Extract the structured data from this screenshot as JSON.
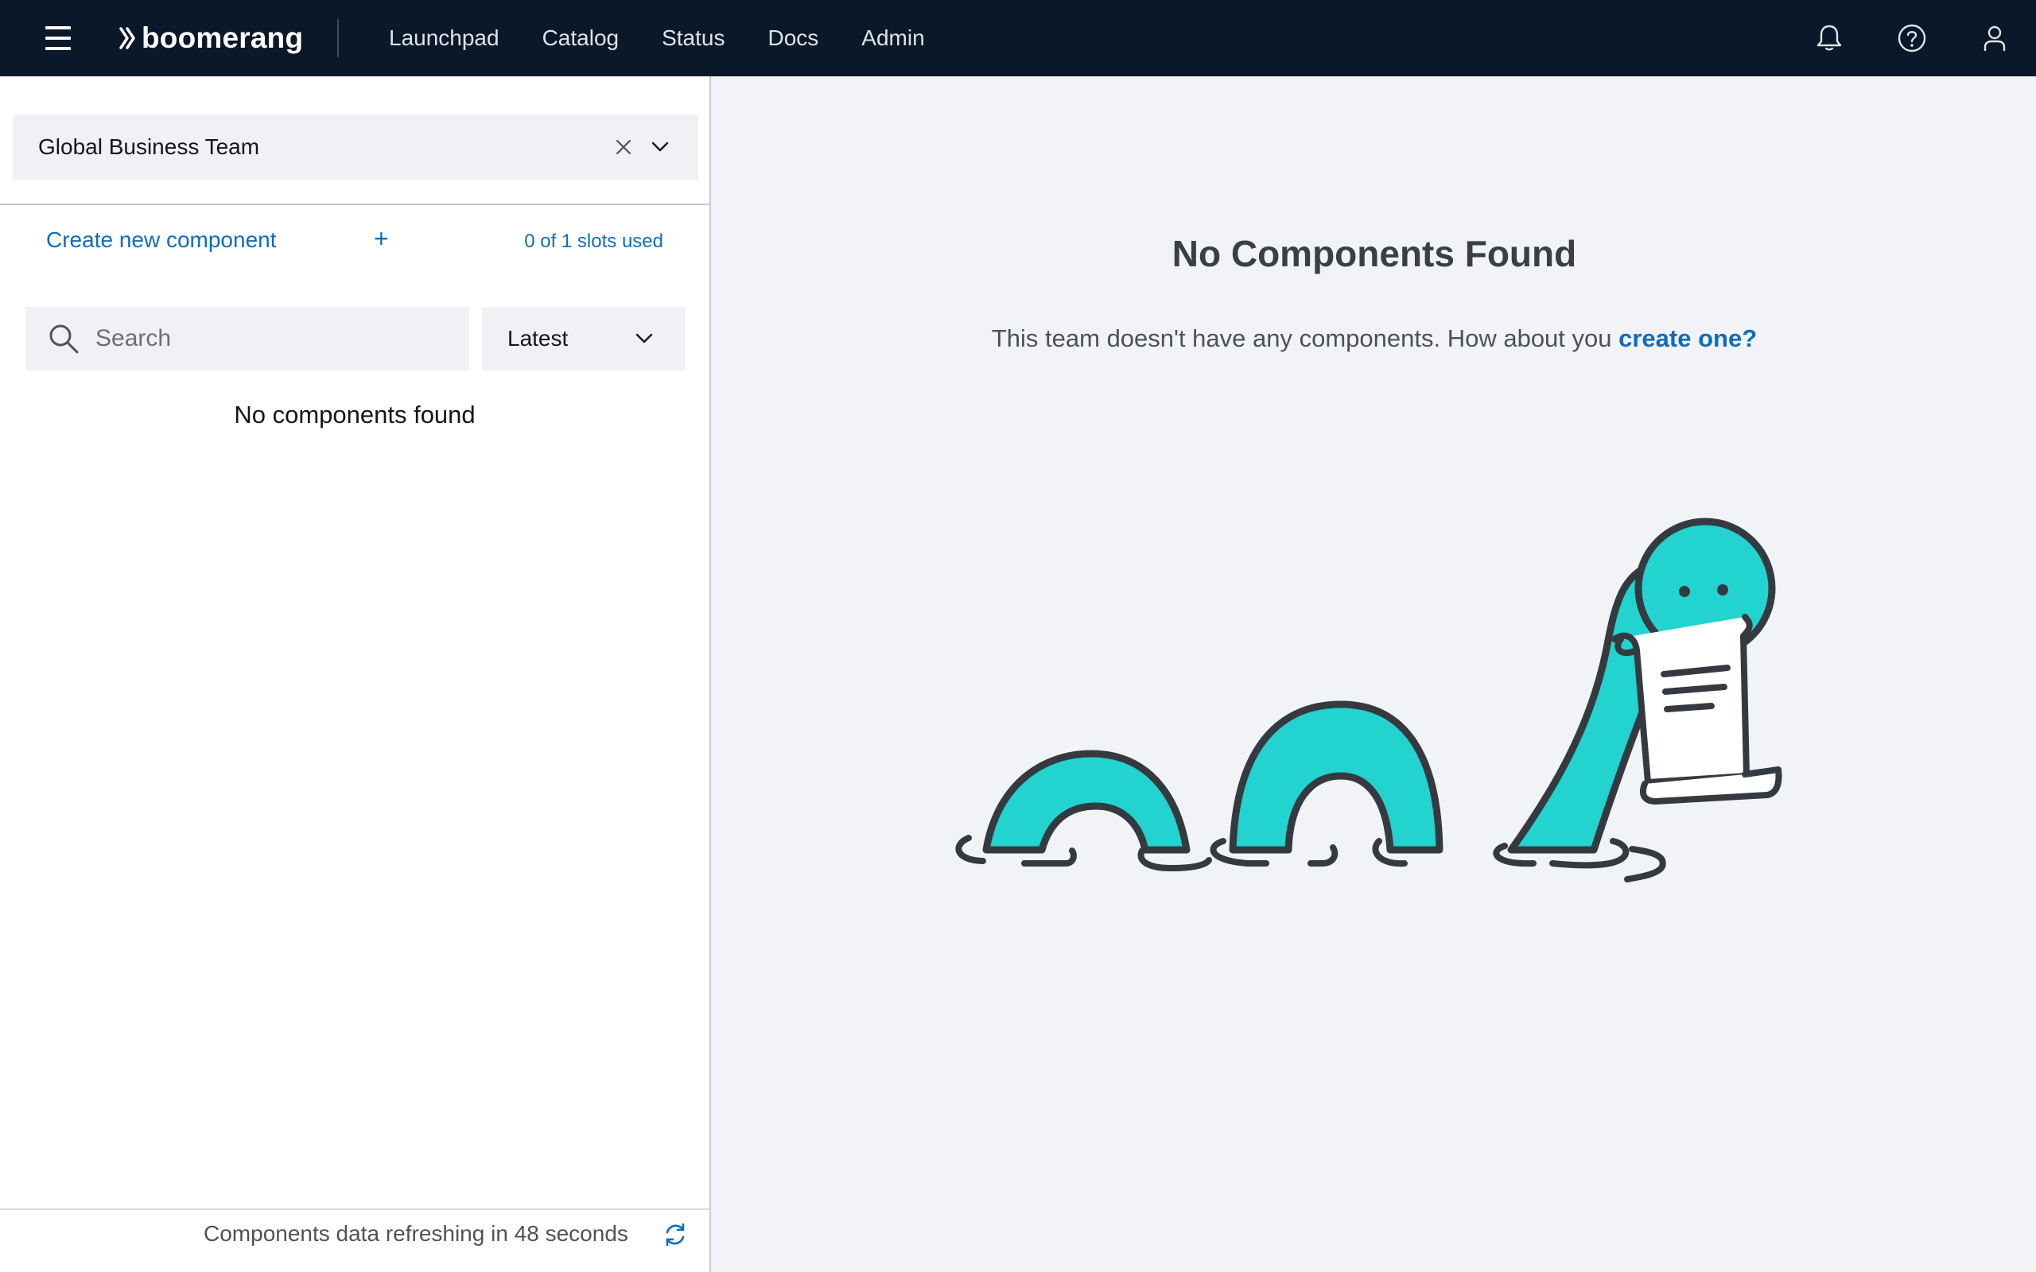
{
  "header": {
    "brand": "boomerang",
    "nav": [
      "Launchpad",
      "Catalog",
      "Status",
      "Docs",
      "Admin"
    ]
  },
  "sidebar": {
    "team_select": "Global Business Team",
    "create_label": "Create new component",
    "create_plus": "+",
    "slots": "0 of 1 slots used",
    "search_placeholder": "Search",
    "sort_value": "Latest",
    "empty_text": "No components found",
    "refresh_text": "Components data refreshing in 48 seconds"
  },
  "main": {
    "title": "No Components Found",
    "subtitle_prefix": "This team doesn't have any components. How about you ",
    "subtitle_link": "create one?"
  },
  "colors": {
    "header_bg": "#0a1829",
    "link": "#0f6cbd",
    "monster": "#22d3d0",
    "outline": "#343a40"
  },
  "icons": [
    "menu-icon",
    "brand-chevron-icon",
    "notification-icon",
    "help-icon",
    "user-icon",
    "close-icon",
    "chevron-down-icon",
    "search-icon",
    "refresh-icon"
  ]
}
